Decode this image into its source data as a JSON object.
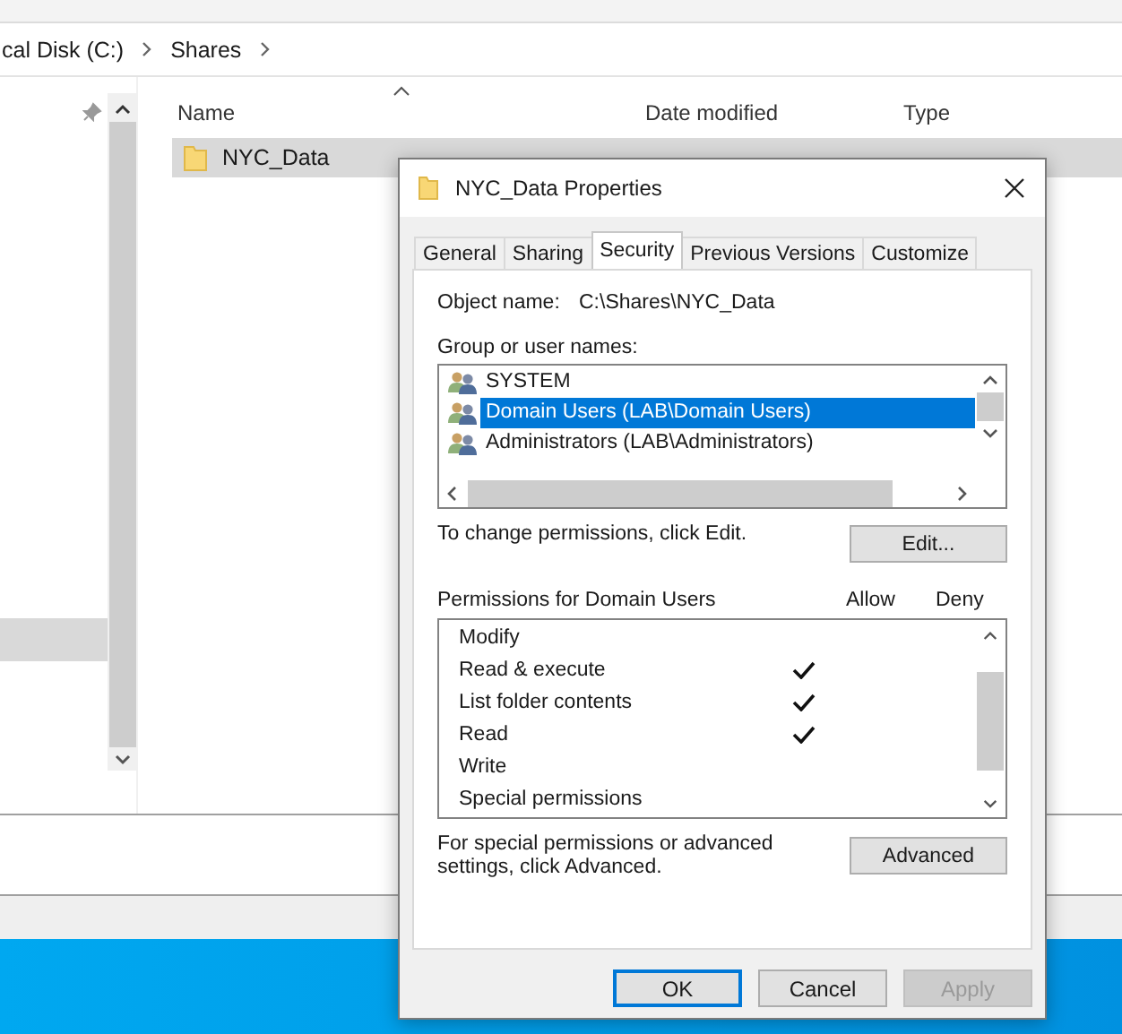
{
  "explorer": {
    "breadcrumb": [
      "cal Disk (C:)",
      "Shares"
    ],
    "columns": [
      "Name",
      "Date modified",
      "Type"
    ],
    "rows": [
      {
        "name": "NYC_Data",
        "selected": true
      }
    ]
  },
  "dialog": {
    "title": "NYC_Data Properties",
    "tabs": [
      {
        "label": "General",
        "selected": false
      },
      {
        "label": "Sharing",
        "selected": false
      },
      {
        "label": "Security",
        "selected": true
      },
      {
        "label": "Previous Versions",
        "selected": false
      },
      {
        "label": "Customize",
        "selected": false
      }
    ],
    "object_name_label": "Object name:",
    "object_name": "C:\\Shares\\NYC_Data",
    "group_label": "Group or user names:",
    "groups": [
      {
        "name": "SYSTEM",
        "selected": false
      },
      {
        "name": "Domain Users (LAB\\Domain Users)",
        "selected": true
      },
      {
        "name": "Administrators (LAB\\Administrators)",
        "selected": false
      }
    ],
    "edit_hint": "To change permissions, click Edit.",
    "edit_button": "Edit...",
    "permissions_label": "Permissions for Domain Users",
    "allow_header": "Allow",
    "deny_header": "Deny",
    "permissions": [
      {
        "name": "Modify",
        "allow": false,
        "deny": false
      },
      {
        "name": "Read & execute",
        "allow": true,
        "deny": false
      },
      {
        "name": "List folder contents",
        "allow": true,
        "deny": false
      },
      {
        "name": "Read",
        "allow": true,
        "deny": false
      },
      {
        "name": "Write",
        "allow": false,
        "deny": false
      },
      {
        "name": "Special permissions",
        "allow": false,
        "deny": false
      }
    ],
    "advanced_hint": "For special permissions or advanced settings, click Advanced.",
    "advanced_button": "Advanced",
    "buttons": [
      {
        "label": "OK",
        "default": true,
        "disabled": false
      },
      {
        "label": "Cancel",
        "default": false,
        "disabled": false
      },
      {
        "label": "Apply",
        "default": false,
        "disabled": true
      }
    ]
  }
}
